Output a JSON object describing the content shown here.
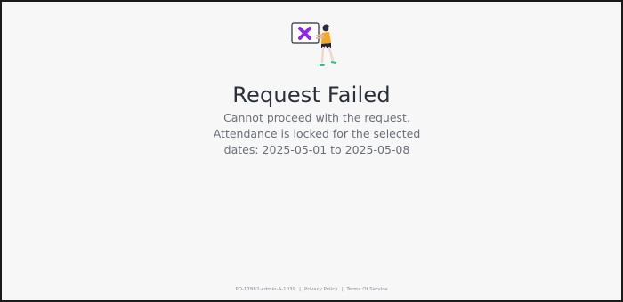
{
  "error_page": {
    "title": "Request Failed",
    "message": "Cannot proceed with the request. Attendance is locked for the selected dates: 2025-05-01 to 2025-05-08",
    "illustration_icon": "error-x-board-person-icon"
  },
  "footer": {
    "page_id": "PD-17862-admin-A-1039",
    "separator": "|",
    "privacy_label": "Privacy Policy",
    "terms_label": "Terms Of Service"
  },
  "colors": {
    "background": "#f7f7f7",
    "title": "#2a2f3a",
    "message": "#6b7078",
    "accent_x": "#8a2be2",
    "person_shirt": "#f5a623",
    "person_shoes": "#2fbf8f"
  }
}
